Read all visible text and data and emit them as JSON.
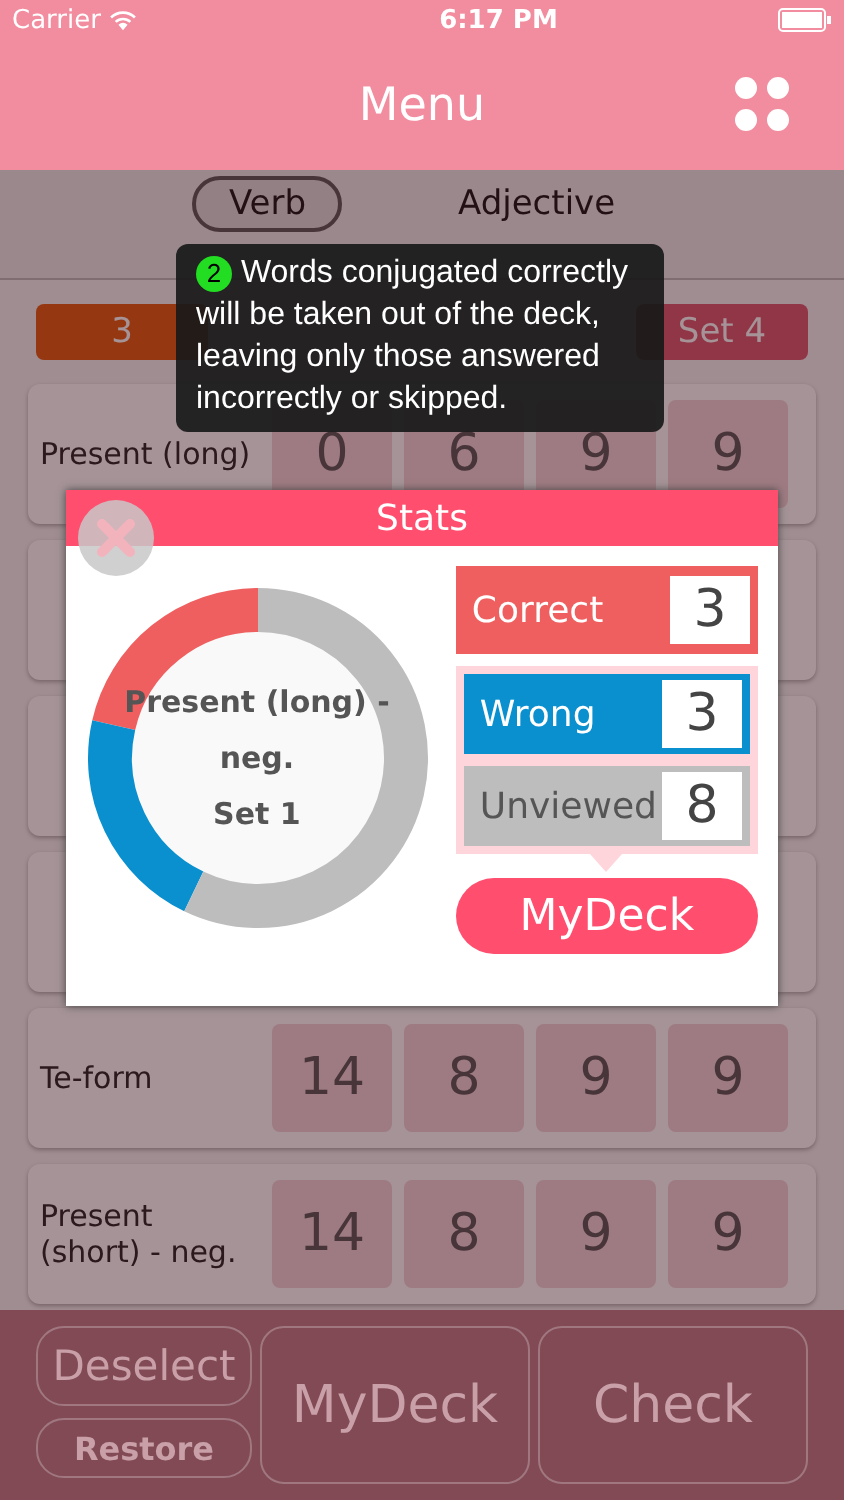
{
  "status_bar": {
    "carrier": "Carrier",
    "time": "6:17 PM"
  },
  "nav": {
    "title": "Menu"
  },
  "tabs": [
    {
      "label": "Verb",
      "selected": true
    },
    {
      "label": "Adjective",
      "selected": false
    }
  ],
  "set_header": [
    {
      "label": "3",
      "selected": true
    },
    {
      "label": "Set 4",
      "selected": false
    }
  ],
  "rows": [
    {
      "label": "Present (long)",
      "counts": [
        "0",
        "6",
        "9",
        "9"
      ]
    },
    {
      "label": "Te-form",
      "counts": [
        "14",
        "8",
        "9",
        "9"
      ]
    },
    {
      "label": "Present (short) - neg.",
      "counts": [
        "14",
        "8",
        "9",
        "9"
      ]
    }
  ],
  "toolbar": {
    "deselect": "Deselect",
    "restore": "Restore",
    "mydeck": "MyDeck",
    "check": "Check"
  },
  "tooltip": {
    "step": "2",
    "text": "Words conjugated correctly will be taken out of the deck, leaving only those answered incorrectly or skipped."
  },
  "stats_popup": {
    "title": "Stats",
    "center_label": [
      "Present (long) -",
      "neg.",
      "Set 1"
    ],
    "stats": [
      {
        "kind": "correct",
        "label": "Correct",
        "value": "3",
        "color": "#ef5f5f"
      },
      {
        "kind": "wrong",
        "label": "Wrong",
        "value": "3",
        "color": "#0a90cf"
      },
      {
        "kind": "unviewed",
        "label": "Unviewed",
        "value": "8",
        "color": "#bdbdbd"
      }
    ],
    "button": "MyDeck"
  }
}
